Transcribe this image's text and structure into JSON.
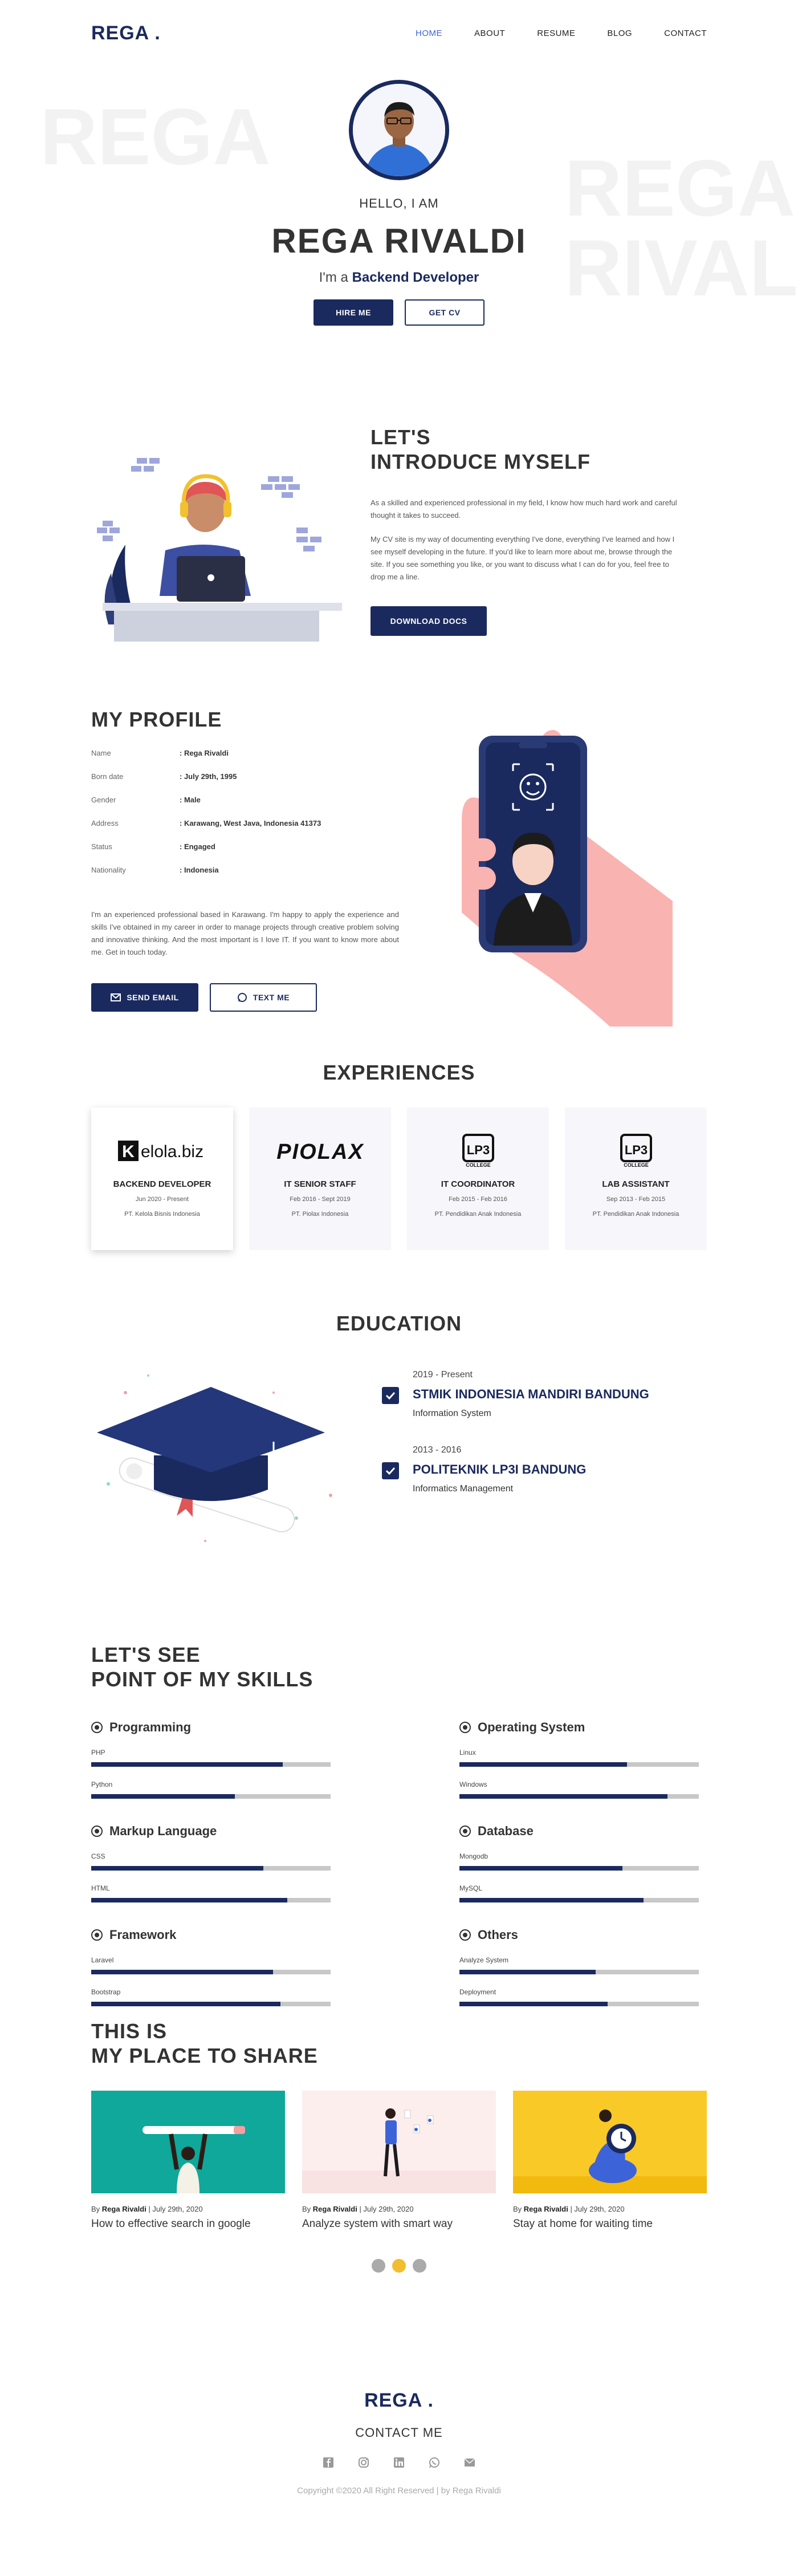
{
  "nav": {
    "logo": "REGA .",
    "items": [
      "HOME",
      "ABOUT",
      "RESUME",
      "BLOG",
      "CONTACT"
    ],
    "active": "HOME"
  },
  "hero": {
    "watermark_left": "REGA",
    "watermark_right_1": "REGA",
    "watermark_right_2": "RIVAL",
    "hello": "HELLO, I AM",
    "name": "REGA RIVALDI",
    "role_prefix": "I'm a ",
    "role": "Backend Developer",
    "hire_label": "HIRE ME",
    "cv_label": "GET CV"
  },
  "intro": {
    "title_1": "LET'S",
    "title_2": "INTRODUCE MYSELF",
    "p1": "As a skilled and experienced professional in my field, I know how much hard work and careful thought it takes to succeed.",
    "p2": "My CV site is my way of documenting everything I've done, everything I've learned and how I see myself developing in the future. If you'd like to learn more about me, browse through the site. If you see something you like, or you want to discuss what I can do for you, feel free to drop me a line.",
    "download_label": "DOWNLOAD DOCS"
  },
  "profile": {
    "title": "MY PROFILE",
    "rows": [
      {
        "k": "Name",
        "v": ": Rega Rivaldi"
      },
      {
        "k": "Born date",
        "v": ": July 29th, 1995"
      },
      {
        "k": "Gender",
        "v": ": Male"
      },
      {
        "k": "Address",
        "v": ": Karawang, West Java, Indonesia 41373"
      },
      {
        "k": "Status",
        "v": ": Engaged"
      },
      {
        "k": "Nationality",
        "v": ": Indonesia"
      }
    ],
    "about": "I'm an experienced professional based in Karawang. I'm happy to apply the experience and skills I've obtained in my career in order to manage projects through creative problem solving and innovative thinking. And the most important is I love IT. If you want to know more about me. Get in touch today.",
    "email_label": "SEND EMAIL",
    "text_label": "TEXT ME"
  },
  "experience": {
    "title": "EXPERIENCES",
    "cards": [
      {
        "logo": "Kelola.biz",
        "title": "BACKEND DEVELOPER",
        "date": "Jun 2020 - Present",
        "company": "PT. Kelola Bisnis Indonesia"
      },
      {
        "logo": "PIOLAX",
        "title": "IT SENIOR STAFF",
        "date": "Feb 2016 - Sept 2019",
        "company": "PT. Piolax Indonesia"
      },
      {
        "logo": "COLLEGE",
        "title": "IT COORDINATOR",
        "date": "Feb 2015 - Feb 2016",
        "company": "PT. Pendidikan Anak Indonesia"
      },
      {
        "logo": "COLLEGE",
        "title": "LAB ASSISTANT",
        "date": "Sep 2013 - Feb 2015",
        "company": "PT. Pendidikan Anak Indonesia"
      }
    ]
  },
  "education": {
    "title": "EDUCATION",
    "items": [
      {
        "year": "2019 - Present",
        "school": "STMIK INDONESIA MANDIRI BANDUNG",
        "major": "Information System"
      },
      {
        "year": "2013 - 2016",
        "school": "POLITEKNIK LP3I BANDUNG",
        "major": "Informatics Management"
      }
    ]
  },
  "skills": {
    "title_1": "LET'S SEE",
    "title_2": "POINT OF MY SKILLS",
    "groups": [
      {
        "name": "Programming",
        "items": [
          {
            "label": "PHP",
            "level": 0.8
          },
          {
            "label": "Python",
            "level": 0.6
          }
        ]
      },
      {
        "name": "Operating System",
        "items": [
          {
            "label": "Linux",
            "level": 0.7
          },
          {
            "label": "Windows",
            "level": 0.87
          }
        ]
      },
      {
        "name": "Markup Language",
        "items": [
          {
            "label": "CSS",
            "level": 0.72
          },
          {
            "label": "HTML",
            "level": 0.82
          }
        ]
      },
      {
        "name": "Database",
        "items": [
          {
            "label": "Mongodb",
            "level": 0.68
          },
          {
            "label": "MySQL",
            "level": 0.77
          }
        ]
      },
      {
        "name": "Framework",
        "items": [
          {
            "label": "Laravel",
            "level": 0.76
          },
          {
            "label": "Bootstrap",
            "level": 0.79
          }
        ]
      },
      {
        "name": "Others",
        "items": [
          {
            "label": "Analyze System",
            "level": 0.57
          },
          {
            "label": "Deployment",
            "level": 0.62
          }
        ]
      }
    ]
  },
  "blog": {
    "title_1": "THIS IS",
    "title_2": "MY PLACE TO SHARE",
    "posts": [
      {
        "by": "By ",
        "author": "Rega Rivaldi",
        "date": " | July 29th, 2020",
        "title": "How to effective search in google",
        "color": "#0fa89b"
      },
      {
        "by": "By ",
        "author": "Rega Rivaldi",
        "date": " | July 29th, 2020",
        "title": "Analyze system with smart way",
        "color": "#fdeeee"
      },
      {
        "by": "By ",
        "author": "Rega Rivaldi",
        "date": " | July 29th, 2020",
        "title": "Stay at home for waiting time",
        "color": "#f9c928"
      }
    ]
  },
  "footer": {
    "logo": "REGA .",
    "contact": "CONTACT ME",
    "socials": [
      "facebook-icon",
      "instagram-icon",
      "linkedin-icon",
      "whatsapp-icon",
      "mail-icon"
    ],
    "copyright": "Copyright ©2020 All Right Reserved | by Rega Rivaldi"
  },
  "colors": {
    "navy": "#1a2a5e",
    "accent": "#3d63d9",
    "dot_active": "#f2bd2f"
  }
}
